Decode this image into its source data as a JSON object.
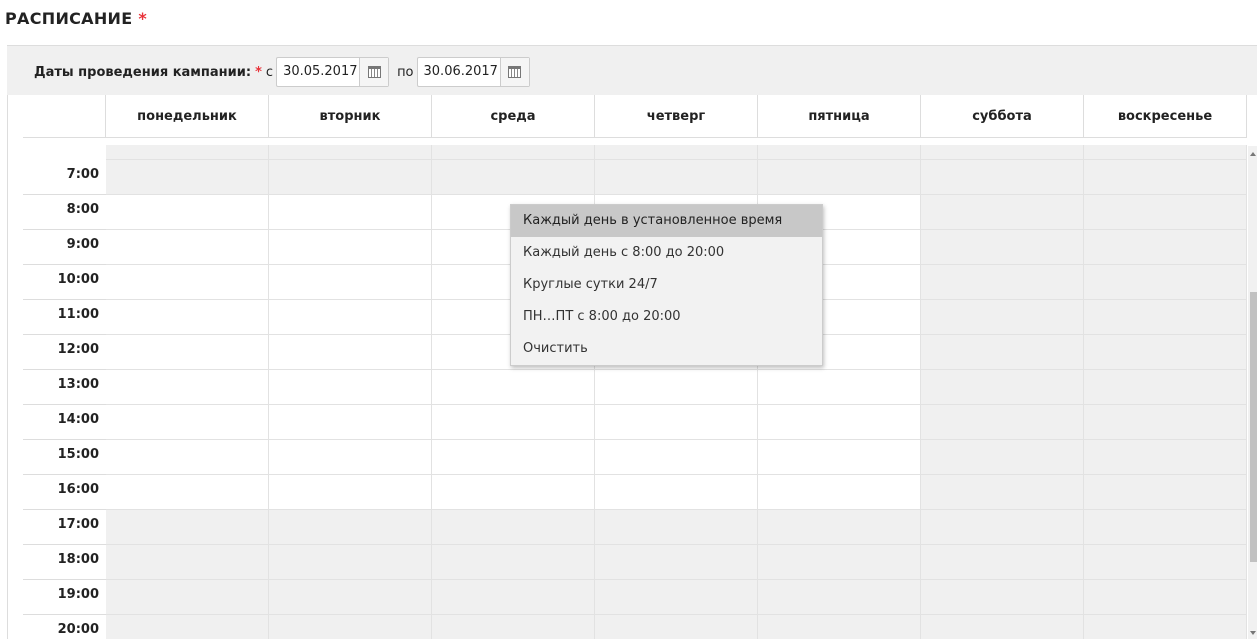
{
  "section": {
    "title": "РАСПИСАНИЕ",
    "required_mark": "*"
  },
  "dates": {
    "label": "Даты проведения кампании:",
    "required_mark": "*",
    "from_label": "с",
    "from_value": "30.05.2017",
    "to_label": "по",
    "to_value": "30.06.2017"
  },
  "schedule": {
    "days": [
      "понедельник",
      "вторник",
      "среда",
      "четверг",
      "пятница",
      "суббота",
      "воскресенье"
    ],
    "times": [
      "7:00",
      "8:00",
      "9:00",
      "10:00",
      "11:00",
      "12:00",
      "13:00",
      "14:00",
      "15:00",
      "16:00",
      "17:00",
      "18:00",
      "19:00",
      "20:00"
    ],
    "selected_days": [
      0,
      1,
      2,
      3,
      4
    ],
    "selected_hours": [
      "8:00",
      "9:00",
      "10:00",
      "11:00",
      "12:00",
      "13:00",
      "14:00",
      "15:00",
      "16:00"
    ],
    "colors": {
      "selected": "#ffffff",
      "unselected": "#f0f0f0"
    }
  },
  "context_menu": {
    "items": [
      "Каждый день в установленное время",
      "Каждый день с 8:00 до 20:00",
      "Круглые сутки 24/7",
      "ПН…ПТ с 8:00 до 20:00",
      "Очистить"
    ],
    "highlighted_index": 0
  }
}
